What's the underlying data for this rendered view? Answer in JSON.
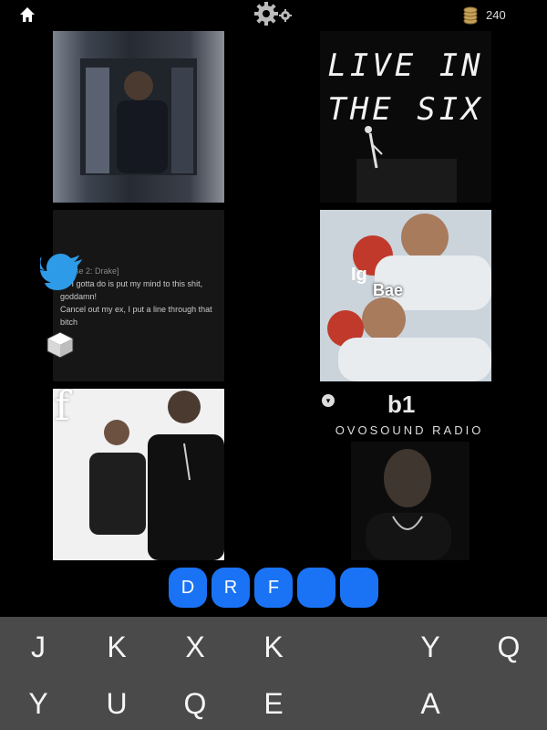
{
  "header": {
    "coin_count": "240"
  },
  "tiles": {
    "live_in_the_six": {
      "text": "LIVE IN\nTHE SIX"
    },
    "lyrics": {
      "lines": [
        "[Verse 2: Drake]",
        "All I gotta do is put my mind to this shit,",
        "goddamn!",
        "Cancel out my ex, I put a line through that",
        "bitch"
      ]
    },
    "bae": {
      "ig": "Ig",
      "caption": "Bae"
    },
    "dance": {
      "letter": "f"
    },
    "radio": {
      "logo": "b1",
      "name": "OVOSOUND RADIO"
    }
  },
  "answer": {
    "slots": [
      "D",
      "R",
      "F",
      "",
      ""
    ]
  },
  "keyboard": {
    "row1": [
      "J",
      "K",
      "X",
      "K",
      "",
      "Y",
      "Q"
    ],
    "row2": [
      "Y",
      "U",
      "Q",
      "E",
      "",
      "A",
      ""
    ]
  },
  "colors": {
    "accent": "#1a73f5",
    "keyboard_bg": "#4a4a4a"
  }
}
